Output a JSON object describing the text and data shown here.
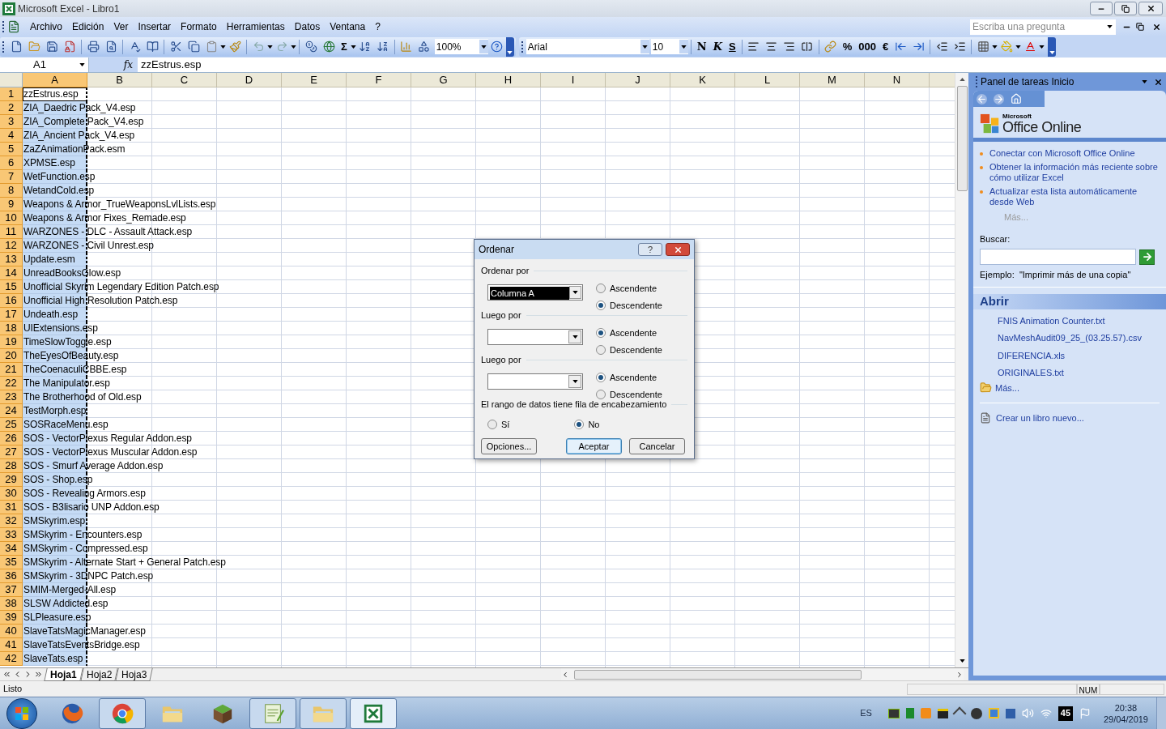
{
  "window": {
    "title": "Microsoft Excel - Libro1"
  },
  "menu": [
    {
      "label": "Archivo"
    },
    {
      "label": "Edición"
    },
    {
      "label": "Ver"
    },
    {
      "label": "Insertar"
    },
    {
      "label": "Formato"
    },
    {
      "label": "Herramientas"
    },
    {
      "label": "Datos"
    },
    {
      "label": "Ventana"
    },
    {
      "label": "?"
    }
  ],
  "help_box": {
    "placeholder": "Escriba una pregunta"
  },
  "standard_toolbar": {
    "sum": "Σ",
    "zoom": "100%"
  },
  "format_toolbar": {
    "font": "Arial",
    "size": "10",
    "bold": "N",
    "italic": "K",
    "underline": "S",
    "percent": "%",
    "thousands": "000",
    "currency": "€"
  },
  "formula_bar": {
    "name_box": "A1",
    "fx": "fx",
    "value": "zzEstrus.esp"
  },
  "sheet": {
    "columns": [
      {
        "label": "A",
        "selected": true
      },
      {
        "label": "B",
        "selected": false
      },
      {
        "label": "C",
        "selected": false
      },
      {
        "label": "D",
        "selected": false
      },
      {
        "label": "E",
        "selected": false
      },
      {
        "label": "F",
        "selected": false
      },
      {
        "label": "G",
        "selected": false
      },
      {
        "label": "H",
        "selected": false
      },
      {
        "label": "I",
        "selected": false
      },
      {
        "label": "J",
        "selected": false
      },
      {
        "label": "K",
        "selected": false
      },
      {
        "label": "L",
        "selected": false
      },
      {
        "label": "M",
        "selected": false
      },
      {
        "label": "N",
        "selected": false
      }
    ],
    "rows": [
      {
        "number": "1",
        "a": "zzEstrus.esp",
        "active": true
      },
      {
        "number": "2",
        "a": "ZIA_Daedric Pack_V4.esp",
        "active": false
      },
      {
        "number": "3",
        "a": "ZIA_Complete Pack_V4.esp",
        "active": false
      },
      {
        "number": "4",
        "a": "ZIA_Ancient Pack_V4.esp",
        "active": false
      },
      {
        "number": "5",
        "a": "ZaZAnimationPack.esm",
        "active": false
      },
      {
        "number": "6",
        "a": "XPMSE.esp",
        "active": false
      },
      {
        "number": "7",
        "a": "WetFunction.esp",
        "active": false
      },
      {
        "number": "8",
        "a": "WetandCold.esp",
        "active": false
      },
      {
        "number": "9",
        "a": "Weapons & Armor_TrueWeaponsLvlLists.esp",
        "active": false
      },
      {
        "number": "10",
        "a": "Weapons & Armor Fixes_Remade.esp",
        "active": false
      },
      {
        "number": "11",
        "a": "WARZONES - DLC - Assault Attack.esp",
        "active": false
      },
      {
        "number": "12",
        "a": "WARZONES - Civil Unrest.esp",
        "active": false
      },
      {
        "number": "13",
        "a": "Update.esm",
        "active": false
      },
      {
        "number": "14",
        "a": "UnreadBooksGlow.esp",
        "active": false
      },
      {
        "number": "15",
        "a": "Unofficial Skyrim Legendary Edition Patch.esp",
        "active": false
      },
      {
        "number": "16",
        "a": "Unofficial High Resolution Patch.esp",
        "active": false
      },
      {
        "number": "17",
        "a": "Undeath.esp",
        "active": false
      },
      {
        "number": "18",
        "a": "UIExtensions.esp",
        "active": false
      },
      {
        "number": "19",
        "a": "TimeSlowToggle.esp",
        "active": false
      },
      {
        "number": "20",
        "a": "TheEyesOfBeauty.esp",
        "active": false
      },
      {
        "number": "21",
        "a": "TheCoenaculiCBBE.esp",
        "active": false
      },
      {
        "number": "22",
        "a": "The Manipulator.esp",
        "active": false
      },
      {
        "number": "23",
        "a": "The Brotherhood of Old.esp",
        "active": false
      },
      {
        "number": "24",
        "a": "TestMorph.esp",
        "active": false
      },
      {
        "number": "25",
        "a": "SOSRaceMenu.esp",
        "active": false
      },
      {
        "number": "26",
        "a": "SOS - VectorPlexus Regular Addon.esp",
        "active": false
      },
      {
        "number": "27",
        "a": "SOS - VectorPlexus Muscular Addon.esp",
        "active": false
      },
      {
        "number": "28",
        "a": "SOS - Smurf Average Addon.esp",
        "active": false
      },
      {
        "number": "29",
        "a": "SOS - Shop.esp",
        "active": false
      },
      {
        "number": "30",
        "a": "SOS - Revealing Armors.esp",
        "active": false
      },
      {
        "number": "31",
        "a": "SOS - B3lisario UNP Addon.esp",
        "active": false
      },
      {
        "number": "32",
        "a": "SMSkyrim.esp",
        "active": false
      },
      {
        "number": "33",
        "a": "SMSkyrim - Encounters.esp",
        "active": false
      },
      {
        "number": "34",
        "a": "SMSkyrim - Compressed.esp",
        "active": false
      },
      {
        "number": "35",
        "a": "SMSkyrim - Alternate Start + General Patch.esp",
        "active": false
      },
      {
        "number": "36",
        "a": "SMSkyrim - 3DNPC Patch.esp",
        "active": false
      },
      {
        "number": "37",
        "a": "SMIM-Merged-All.esp",
        "active": false
      },
      {
        "number": "38",
        "a": "SLSW Addicted.esp",
        "active": false
      },
      {
        "number": "39",
        "a": "SLPleasure.esp",
        "active": false
      },
      {
        "number": "40",
        "a": "SlaveTatsMagicManager.esp",
        "active": false
      },
      {
        "number": "41",
        "a": "SlaveTatsEventsBridge.esp",
        "active": false
      },
      {
        "number": "42",
        "a": "SlaveTats.esp",
        "active": false
      }
    ]
  },
  "sheet_tabs": [
    {
      "label": "Hoja1",
      "selected": true
    },
    {
      "label": "Hoja2",
      "selected": false
    },
    {
      "label": "Hoja3",
      "selected": false
    }
  ],
  "status_bar": {
    "text": "Listo",
    "num": "NUM"
  },
  "task_pane": {
    "title": "Panel de tareas Inicio",
    "logo_small": "Microsoft",
    "logo": "Office Online",
    "links": [
      "Conectar con Microsoft Office Online",
      "Obtener la información más reciente sobre cómo utilizar Excel",
      "Actualizar esta lista automáticamente desde Web"
    ],
    "more": "Más...",
    "search_label": "Buscar:",
    "example": "Ejemplo:  \"Imprimir más de una copia\"",
    "open_title": "Abrir",
    "files": [
      "FNIS Animation Counter.txt",
      "NavMeshAudit09_25_(03.25.57).csv",
      "DIFERENCIA.xls",
      "ORIGINALES.txt"
    ],
    "open_more": "Más...",
    "new_book": "Crear un libro nuevo..."
  },
  "dialog": {
    "title": "Ordenar",
    "help": "?",
    "sort_keys": [
      {
        "label": "Ordenar por",
        "value": "Columna A",
        "options": [
          {
            "label": "Ascendente",
            "selected": false
          },
          {
            "label": "Descendente",
            "selected": true
          }
        ]
      },
      {
        "label": "Luego por",
        "options": [
          {
            "label": "Ascendente",
            "selected": true
          },
          {
            "label": "Descendente",
            "selected": false
          }
        ]
      },
      {
        "label": "Luego por",
        "options": [
          {
            "label": "Ascendente",
            "selected": true
          },
          {
            "label": "Descendente",
            "selected": false
          }
        ]
      }
    ],
    "header_row": {
      "label": "El rango de datos tiene fila de encabezamiento",
      "options": [
        {
          "label": "Sí",
          "selected": false
        },
        {
          "label": "No",
          "selected": true
        }
      ]
    },
    "buttons": [
      {
        "label": "Opciones...",
        "kind": "plain"
      },
      {
        "label": "Aceptar",
        "kind": "default"
      },
      {
        "label": "Cancelar",
        "kind": "plain"
      }
    ]
  },
  "taskbar": {
    "apps": [
      {
        "kind": "fox",
        "open": false,
        "selected": false
      },
      {
        "kind": "chrome",
        "open": true,
        "selected": false
      },
      {
        "kind": "folder",
        "open": false,
        "selected": false
      },
      {
        "kind": "block",
        "open": false,
        "selected": false
      },
      {
        "kind": "editor",
        "open": true,
        "selected": false
      },
      {
        "kind": "folder",
        "open": true,
        "selected": false
      },
      {
        "kind": "sheet",
        "open": true,
        "selected": true
      }
    ],
    "language": "ES",
    "badge": "45",
    "time": "20:38",
    "date": "29/04/2019"
  }
}
